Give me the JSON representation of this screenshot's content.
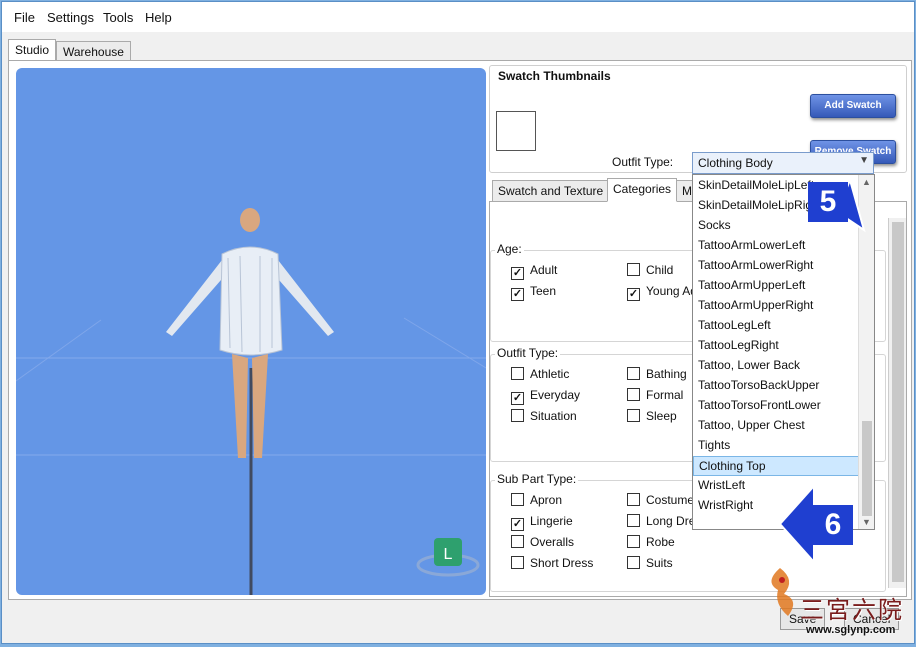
{
  "menubar": {
    "items": [
      "File",
      "Settings",
      "Tools",
      "Help"
    ]
  },
  "top_tabs": [
    "Studio",
    "Warehouse"
  ],
  "swatch": {
    "title": "Swatch Thumbnails",
    "add_label": "Add Swatch",
    "remove_label": "Remove Swatch"
  },
  "sub_tabs": [
    "Swatch and Texture",
    "Categories",
    "Meshes"
  ],
  "outfit_type": {
    "label": "Outfit Type:",
    "selected": "Clothing Body"
  },
  "age": {
    "title": "Age:",
    "options": [
      {
        "label": "Adult",
        "checked": "✓"
      },
      {
        "label": "Child",
        "checked": ""
      },
      {
        "label": "Teen",
        "checked": "✓"
      },
      {
        "label": "Young Adult",
        "checked": "✓"
      }
    ]
  },
  "outfit_group": {
    "title": "Outfit Type:",
    "options": [
      {
        "label": "Athletic",
        "checked": ""
      },
      {
        "label": "Bathing",
        "checked": ""
      },
      {
        "label": "Everyday",
        "checked": "✓"
      },
      {
        "label": "Formal",
        "checked": ""
      },
      {
        "label": "Situation",
        "checked": ""
      },
      {
        "label": "Sleep",
        "checked": ""
      }
    ]
  },
  "subpart": {
    "title": "Sub Part Type:",
    "options": [
      {
        "label": "Apron",
        "checked": ""
      },
      {
        "label": "Costume",
        "checked": ""
      },
      {
        "label": "Lingerie",
        "checked": "✓"
      },
      {
        "label": "Long Dress",
        "checked": ""
      },
      {
        "label": "Overalls",
        "checked": ""
      },
      {
        "label": "Robe",
        "checked": ""
      },
      {
        "label": "Short Dress",
        "checked": ""
      },
      {
        "label": "Suits",
        "checked": ""
      }
    ]
  },
  "dropdown_items": [
    "SkinDetailMoleLipLeft",
    "SkinDetailMoleLipRight",
    "Socks",
    "TattooArmLowerLeft",
    "TattooArmLowerRight",
    "TattooArmUpperLeft",
    "TattooArmUpperRight",
    "TattooLegLeft",
    "TattooLegRight",
    "Tattoo, Lower Back",
    "TattooTorsoBackUpper",
    "TattooTorsoFrontLower",
    "Tattoo, Upper Chest",
    "Tights",
    "Clothing Top",
    "WristLeft",
    "WristRight"
  ],
  "dropdown_selected_index": 14,
  "markers": [
    "5",
    "6"
  ],
  "viewport": {
    "lod_badge": "L"
  },
  "bottom": {
    "save": "Save",
    "cancel": "Cancel"
  },
  "watermark": {
    "text": "三宮六院",
    "url": "www.sglynp.com"
  },
  "colors": {
    "viewport_bg": "#6496e6",
    "accent": "#1f3fd0",
    "selected_item": "#cde8ff"
  }
}
